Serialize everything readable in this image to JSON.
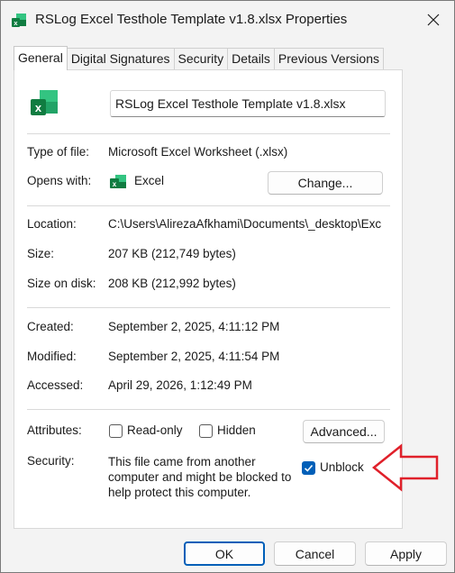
{
  "window": {
    "title": "RSLog Excel Testhole Template v1.8.xlsx Properties"
  },
  "tabs": [
    {
      "label": "General",
      "active": true
    },
    {
      "label": "Digital Signatures"
    },
    {
      "label": "Security"
    },
    {
      "label": "Details"
    },
    {
      "label": "Previous Versions"
    }
  ],
  "general": {
    "file_name": "RSLog Excel Testhole Template v1.8.xlsx",
    "type_label": "Type of file:",
    "type_value": "Microsoft Excel Worksheet (.xlsx)",
    "opens_label": "Opens with:",
    "opens_value": "Excel",
    "change_button": "Change...",
    "location_label": "Location:",
    "location_value": "C:\\Users\\AlirezaAfkhami\\Documents\\_desktop\\Exc",
    "size_label": "Size:",
    "size_value": "207 KB (212,749 bytes)",
    "size_on_disk_label": "Size on disk:",
    "size_on_disk_value": "208 KB (212,992 bytes)",
    "created_label": "Created:",
    "created_value": "September 2, 2025, 4:11:12 PM",
    "modified_label": "Modified:",
    "modified_value": "September 2, 2025, 4:11:54 PM",
    "accessed_label": "Accessed:",
    "accessed_value": "April 29, 2026, 1:12:49 PM",
    "attributes_label": "Attributes:",
    "readonly_label": "Read-only",
    "readonly_checked": false,
    "hidden_label": "Hidden",
    "hidden_checked": false,
    "advanced_button": "Advanced...",
    "security_label": "Security:",
    "security_line1": "This file came from another",
    "security_line2": "computer and might be blocked to",
    "security_line3": "help protect this computer.",
    "unblock_label": "Unblock",
    "unblock_checked": true
  },
  "footer": {
    "ok": "OK",
    "cancel": "Cancel",
    "apply": "Apply"
  },
  "colors": {
    "accent": "#005fb8",
    "excel_green": "#107c41",
    "annotation_arrow": "#e0202a"
  }
}
